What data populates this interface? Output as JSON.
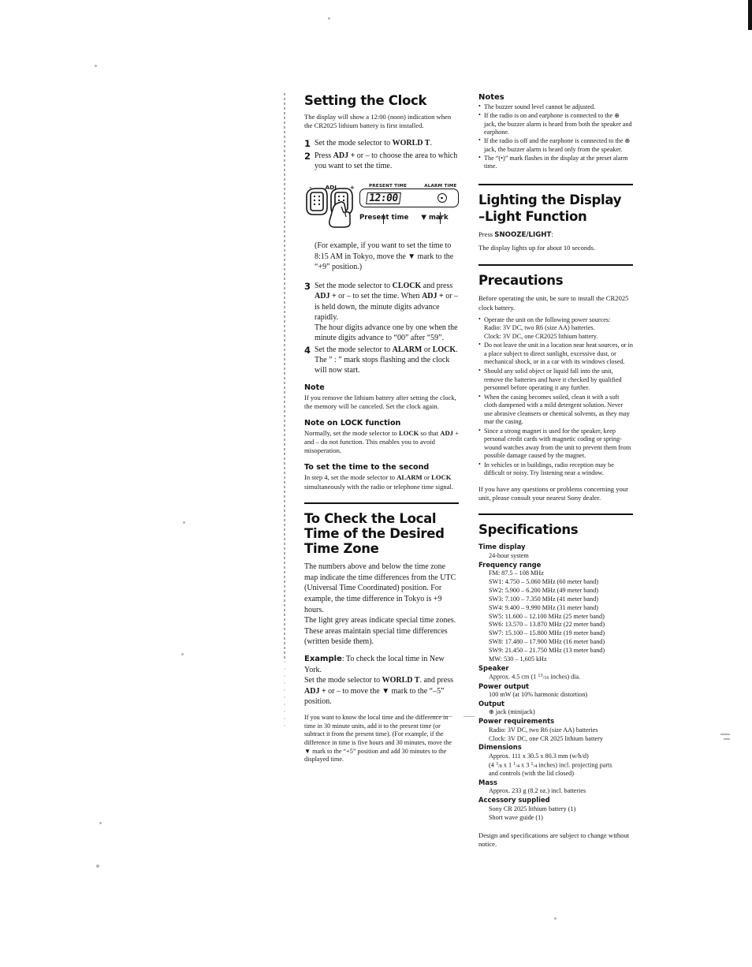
{
  "document": {
    "type": "sony-radio-operating-instructions-page"
  },
  "left_column": {
    "clock": {
      "heading": "Setting the Clock",
      "intro": "The display will show a 12:00 (noon) indication when the CR2025 lithium battery is first installed.",
      "steps": [
        {
          "num": "1",
          "text_parts": [
            "Set the mode selector to ",
            "WORLD T",
            "."
          ]
        },
        {
          "num": "2",
          "text_parts": [
            "Press ",
            "ADJ +",
            " or – to choose the area to which you want to set the time."
          ]
        }
      ],
      "illustration": {
        "adj_minus": "–",
        "adj_name": "ADJ",
        "adj_plus": "+",
        "tag_present": "PRESENT TIME",
        "tag_alarm": "ALARM TIME",
        "lcd_value": "12:00",
        "callout_present": "Present time",
        "callout_mark": "▼ mark"
      },
      "example_note": "(For example, if you want to set the time to 8:15 AM in Tokyo, move the ▼ mark to the “+9” position.)",
      "steps2": [
        {
          "num": "3",
          "text": "Set the mode selector to CLOCK and press ADJ + or – to set the time. When ADJ + or – is held down, the minute digits advance rapidly. The hour digits advance one by one when the minute digits advance to “00” after “59”."
        },
        {
          "num": "4",
          "text": "Set the mode selector to ALARM or LOCK. The ” : ” mark stops flashing and the clock will now start."
        }
      ],
      "note_heading": "Note",
      "note_body": "If you remove the lithium battery after setting the clock, the memory will be canceled. Set the clock again.",
      "lock_heading": "Note on LOCK function",
      "lock_body": "Normally, set the mode selector to LOCK so that ADJ + and – do not function. This enables you to avoid misoperation.",
      "second_heading": "To set the time to the second",
      "second_body": "In step 4, set the mode selector to ALARM or LOCK simultaneously with the radio or telephone time signal."
    },
    "localtime": {
      "heading": "To Check the Local Time of the Desired Time Zone",
      "body": "The numbers above and below the time zone map indicate the time differences from the UTC (Universal Time Coordinated) position. For example, the time difference in Tokyo is +9 hours.\nThe light grey areas indicate special time zones. These areas maintain special time differences (written beside them).",
      "example_label": "Example",
      "example_body": ": To check the local time in New York.\nSet the mode selector to WORLD T. and press ADJ + or – to move the ▼ mark to the “–5” position.",
      "footnote": "If you want to know the local time and the difference in time in 30 minute units, add it to the present time (or subtract it from the present time). (For example, if the difference in time is five hours and 30 minutes, move the ▼ mark to the “+5” position and add 30 minutes to the displayed time."
    }
  },
  "right_column": {
    "notes": {
      "heading": "Notes",
      "items": [
        "The buzzer sound level cannot be adjusted.",
        "If the radio is on and earphone is connected to the ⊕ jack, the buzzer alarm is heard from both the speaker and earphone.",
        "If the radio is off and the earphone is connected to the ⊕ jack, the buzzer alarm is heard only from the speaker.",
        "The “(•)” mark flashes in the display at the preset alarm time."
      ]
    },
    "lighting": {
      "heading_line1": "Lighting the Display",
      "heading_line2": "–Light Function",
      "press_label": "Press ",
      "press_button": "SNOOZE/LIGHT",
      "press_colon": ":",
      "body": "The display lights up for about 10 seconds."
    },
    "precautions": {
      "heading": "Precautions",
      "intro": "Before operating the unit, be sure to install the CR2025 clock battery.",
      "items": [
        "Operate the unit on the following power sources:\nRadio: 3V DC, two R6 (size AA) batteries.\nClock: 3V DC, one CR2025 lithium battery.",
        "Do not leave the unit in a location near heat sources, or in a place subject to direct sunlight, excessive dust, or mechanical shock, or in a car with its windows closed.",
        "Should any solid object or liquid fall into the unit, remove the batteries and have it checked by qualified personnel before operating it any further.",
        "When the casing becomes soiled, clean it with a soft cloth dampened with a mild detergent solution. Never use abrasive cleansers or chemical solvents, as they may mar the casing.",
        "Since a strong magnet is used for the speaker, keep personal credit cards with magnetic coding or spring- wound watches away from the unit to prevent them from possible damage caused by the magnet.",
        "In vehicles or in buildings, radio reception may be difficult or noisy. Try listening near a window."
      ],
      "closing": "If you have any questions or problems concerning your unit, please consult your nearest Sony dealer."
    },
    "specifications": {
      "heading": "Specifications",
      "groups": [
        {
          "name": "Time display",
          "values": [
            "24-hour system"
          ]
        },
        {
          "name": "Frequency range",
          "values": [
            "FM: 87.5 – 108 MHz",
            "SW1: 4.750 – 5.060 MHz (60 meter band)",
            "SW2: 5.900 – 6.200 MHz (49 meter band)",
            "SW3: 7.100 – 7.350 MHz (41 meter band)",
            "SW4: 9.400 – 9.990 MHz (31 meter band)",
            "SW5: 11.600 – 12.100 MHz (25 meter band)",
            "SW6: 13.570 – 13.870 MHz (22 meter band)",
            "SW7: 15.100 – 15.800 MHz (19 meter band)",
            "SW8: 17.480 – 17.900 MHz (16 meter band)",
            "SW9: 21.450 – 21.750 MHz (13 meter band)",
            "MW: 530 – 1,605 kHz"
          ]
        },
        {
          "name": "Speaker",
          "values": [
            "Approx. 4.5 cm (1 13/16 inches) dia."
          ]
        },
        {
          "name": "Power output",
          "values": [
            "100 mW (at 10% harmonic distortion)"
          ]
        },
        {
          "name": "Output",
          "values": [
            "⊕ jack (minijack)"
          ]
        },
        {
          "name": "Power requirements",
          "values": [
            "Radio: 3V DC, two R6 (size AA) batteries",
            "Clock: 3V DC, one CR 2025 lithium battery"
          ]
        },
        {
          "name": "Dimensions",
          "values": [
            "Approx. 111 x 30.5 x 80.3 mm (w/h/d)",
            "(4 3/8 x 1 1/4 x 3 1/4 inches) incl. projecting parts",
            "and controls (with the lid closed)"
          ]
        },
        {
          "name": "Mass",
          "values": [
            "Approx. 233 g (8.2 oz.) incl. batteries"
          ]
        },
        {
          "name": "Accessory supplied",
          "values": [
            "Sony CR 2025 lithium battery (1)",
            "Short wave guide (1)"
          ]
        }
      ],
      "disclaimer": "Design and specifications are subject to change without notice."
    }
  }
}
